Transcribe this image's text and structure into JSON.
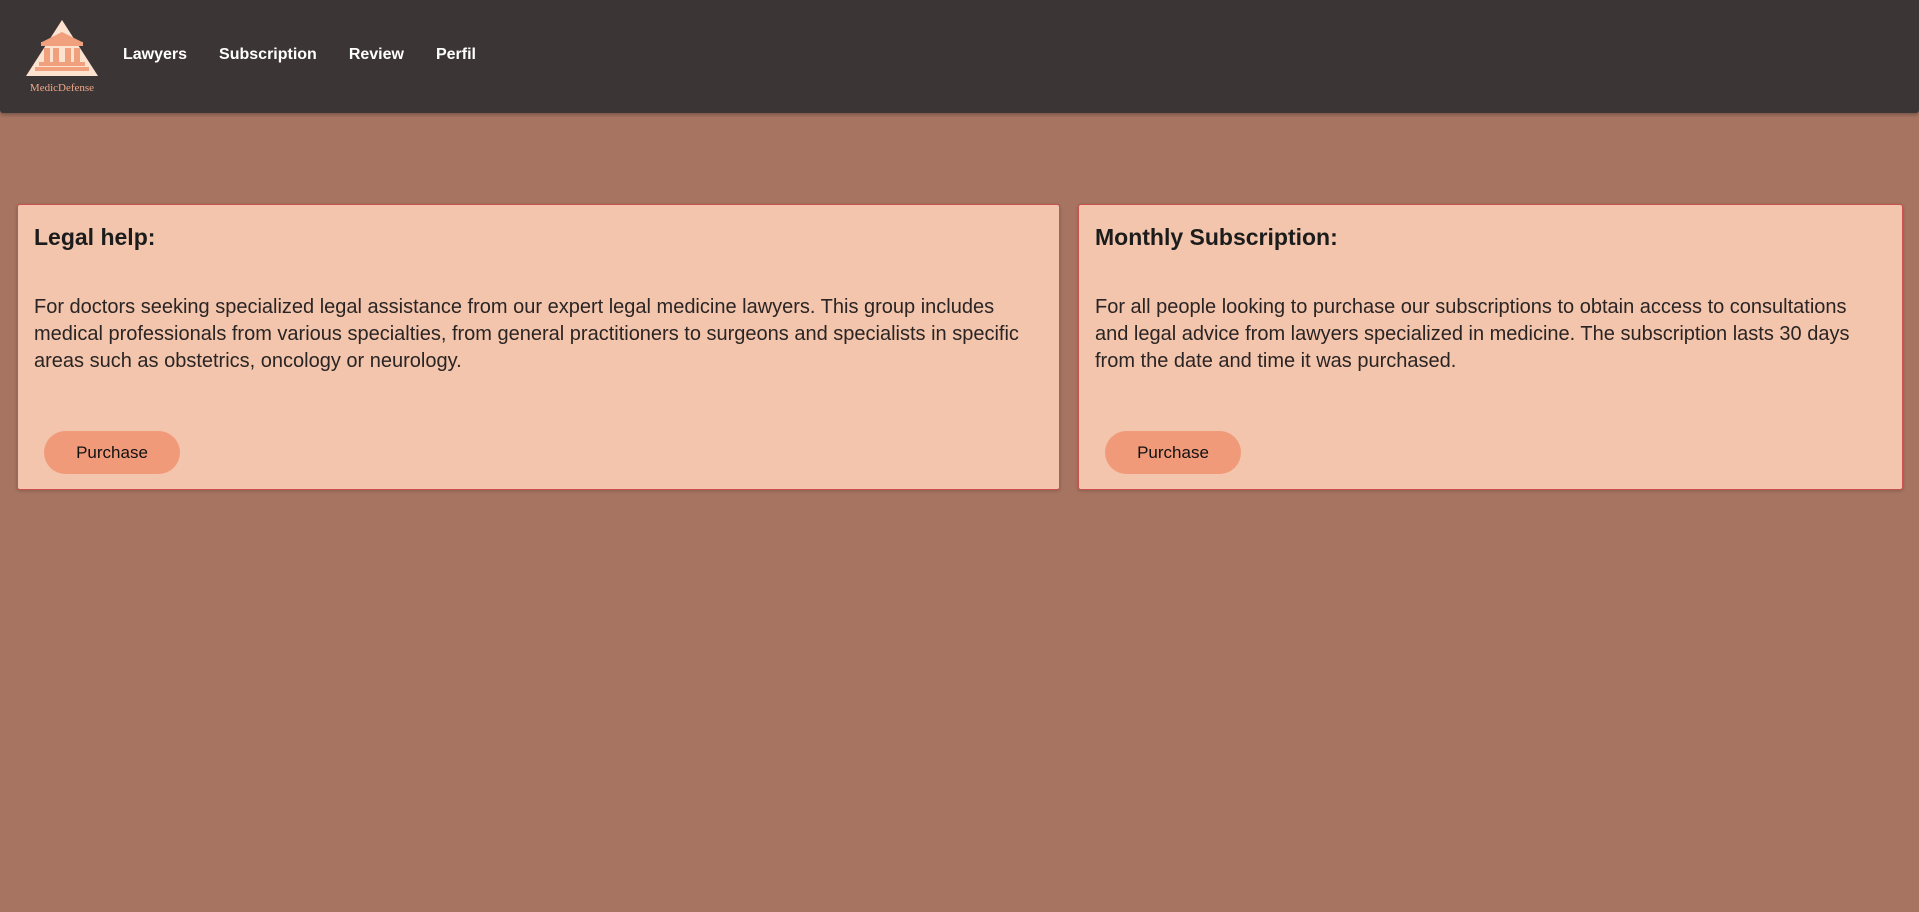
{
  "brand": {
    "name": "MedicDefense",
    "logo_icon": "courthouse-icon"
  },
  "nav": {
    "items": [
      {
        "label": "Lawyers"
      },
      {
        "label": "Subscription"
      },
      {
        "label": "Review"
      },
      {
        "label": "Perfil"
      }
    ]
  },
  "cards": [
    {
      "title": "Legal help:",
      "description": "For doctors seeking specialized legal assistance from our expert legal medicine lawyers. This group includes medical professionals from various specialties, from general practitioners to surgeons and specialists in specific areas such as obstetrics, oncology or neurology.",
      "button_label": "Purchase"
    },
    {
      "title": "Monthly Subscription:",
      "description": "For all people looking to purchase our subscriptions to obtain access to consultations and legal advice from lawyers specialized in medicine. The subscription lasts 30 days from the date and time it was purchased.",
      "button_label": "Purchase"
    }
  ],
  "colors": {
    "page_background": "#a67461",
    "navbar_background": "#3c3536",
    "card_background": "#f2c5ac",
    "card_border": "#c9524f",
    "button_background": "#f19a7a",
    "logo_accent": "#f0a888"
  }
}
